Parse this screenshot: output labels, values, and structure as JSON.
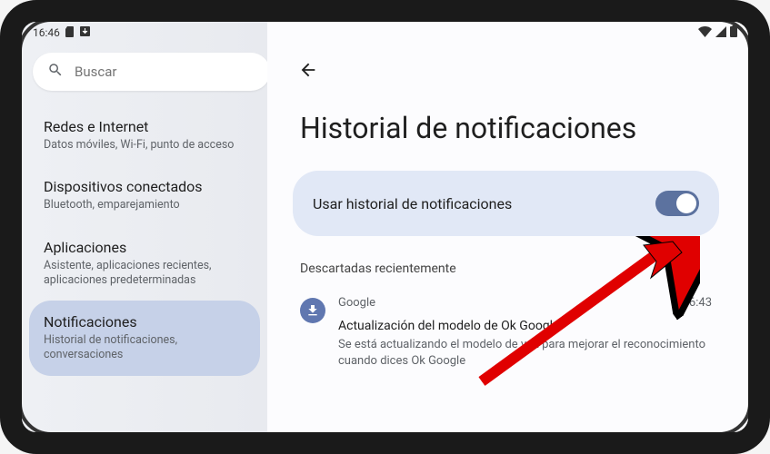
{
  "status": {
    "time": "16:46"
  },
  "search": {
    "placeholder": "Buscar"
  },
  "sidebar": {
    "items": [
      {
        "title": "Redes e Internet",
        "sub": "Datos móviles, Wi-Fi, punto de acceso"
      },
      {
        "title": "Dispositivos conectados",
        "sub": "Bluetooth, emparejamiento"
      },
      {
        "title": "Aplicaciones",
        "sub": "Asistente, aplicaciones recientes, aplicaciones predeterminadas"
      },
      {
        "title": "Notificaciones",
        "sub": "Historial de notificaciones, conversaciones"
      }
    ]
  },
  "page": {
    "title": "Historial de notificaciones",
    "toggle_label": "Usar historial de notificaciones",
    "recent_header": "Descartadas recientemente"
  },
  "notification": {
    "app": "Google",
    "time": "16:43",
    "title": "Actualización del modelo de Ok Google",
    "desc": "Se está actualizando el modelo de voz para mejorar el reconocimiento cuando dices Ok Google"
  }
}
